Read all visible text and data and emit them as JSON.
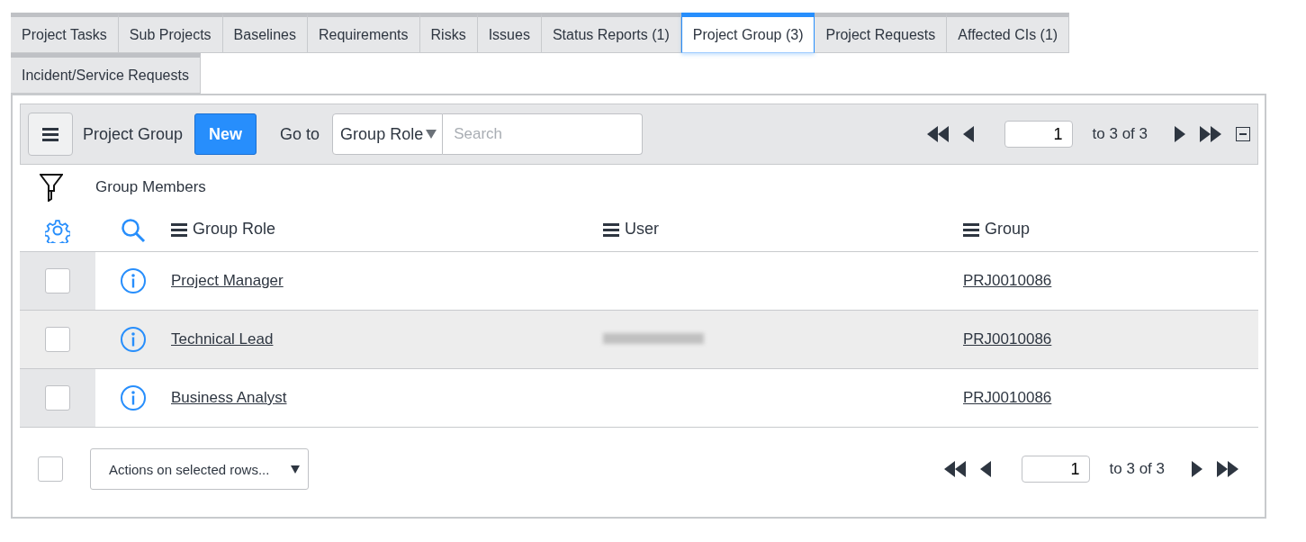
{
  "tabs": [
    {
      "label": "Project Tasks",
      "selected": false
    },
    {
      "label": "Sub Projects",
      "selected": false
    },
    {
      "label": "Baselines",
      "selected": false
    },
    {
      "label": "Requirements",
      "selected": false
    },
    {
      "label": "Risks",
      "selected": false
    },
    {
      "label": "Issues",
      "selected": false
    },
    {
      "label": "Status Reports (1)",
      "selected": false
    },
    {
      "label": "Project Group (3)",
      "selected": true
    },
    {
      "label": "Project Requests",
      "selected": false
    },
    {
      "label": "Affected CIs (1)",
      "selected": false
    },
    {
      "label": "Incident/Service Requests",
      "selected": false
    }
  ],
  "toolbar": {
    "title": "Project Group",
    "new_button": "New",
    "goto_label": "Go to",
    "goto_field": "Group Role",
    "search": {
      "placeholder": "Search"
    },
    "page": "1",
    "range": "to 3 of 3"
  },
  "filter": {
    "label": "Group Members"
  },
  "table": {
    "columns": [
      "Group Role",
      "User",
      "Group"
    ],
    "rows": [
      {
        "checked": false,
        "highlighted": false,
        "group_role": "Project Manager",
        "user_redacted": false,
        "group": "PRJ0010086"
      },
      {
        "checked": false,
        "highlighted": true,
        "group_role": "Technical Lead",
        "user_redacted": true,
        "group": "PRJ0010086"
      },
      {
        "checked": false,
        "highlighted": false,
        "group_role": "Business Analyst",
        "user_redacted": false,
        "group": "PRJ0010086"
      }
    ]
  },
  "footer": {
    "select_all_checked": false,
    "actions": "Actions on selected rows...",
    "page": "1",
    "range": "to 3 of 3"
  }
}
